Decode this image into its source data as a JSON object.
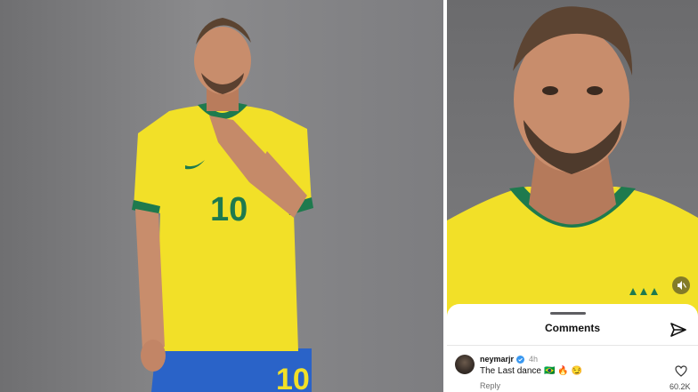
{
  "left_photo": {
    "jersey_number": "10",
    "shorts_number": "10"
  },
  "right_post": {
    "comments_sheet": {
      "title": "Comments",
      "comment": {
        "username": "neymarjr",
        "time": "4h",
        "text": "The Last dance",
        "emojis": [
          "🇧🇷",
          "🔥",
          "😏"
        ],
        "reply_label": "Reply",
        "like_count": "60.2K"
      }
    }
  },
  "colors": {
    "jersey_yellow": "#f2e028",
    "jersey_green": "#1e7a4e",
    "shorts_blue": "#2a63c8",
    "backdrop_grey": "#7b7b7d",
    "verified_blue": "#3897f0"
  },
  "icons": [
    "send-icon",
    "verified-icon",
    "heart-icon",
    "mute-icon"
  ]
}
